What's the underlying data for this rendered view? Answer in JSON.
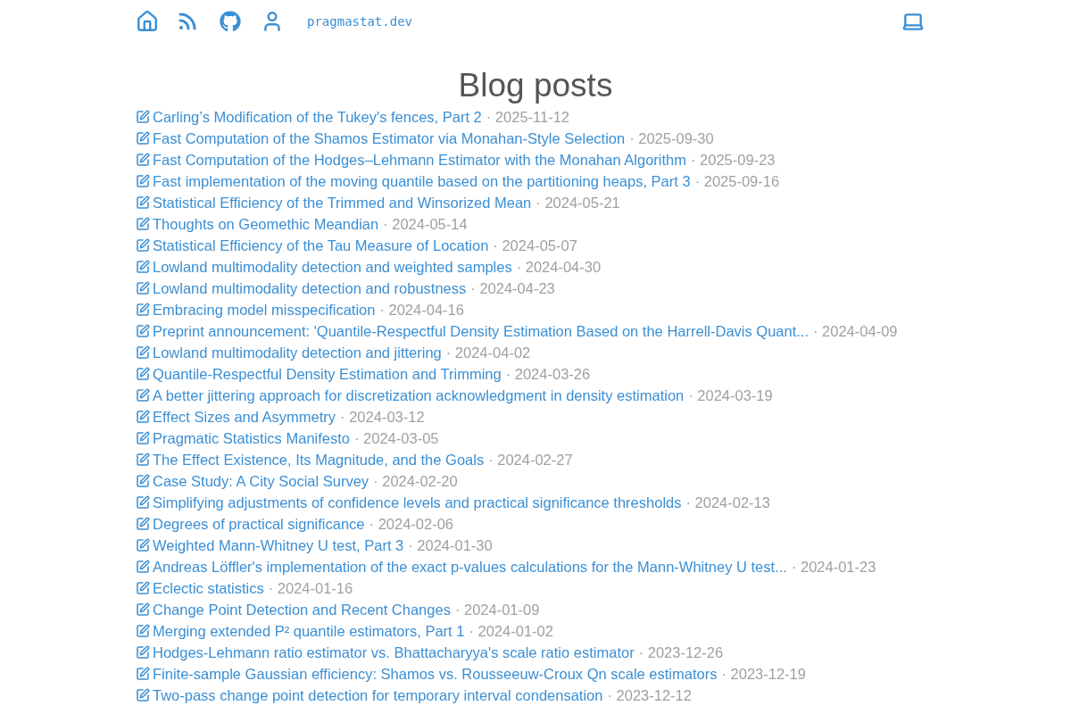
{
  "header": {
    "site": "pragmastat.dev"
  },
  "title": "Blog posts",
  "posts": [
    {
      "title": "Carling’s Modification of the Tukey's fences, Part 2",
      "date": "· 2025-11-12"
    },
    {
      "title": "Fast Computation of the Shamos Estimator via Monahan-Style Selection",
      "date": "· 2025-09-30"
    },
    {
      "title": "Fast Computation of the Hodges–Lehmann Estimator with the Monahan Algorithm",
      "date": "· 2025-09-23"
    },
    {
      "title": "Fast implementation of the moving quantile based on the partitioning heaps, Part 3",
      "date": "· 2025-09-16"
    },
    {
      "title": "Statistical Efficiency of the Trimmed and Winsorized Mean",
      "date": "· 2024-05-21"
    },
    {
      "title": "Thoughts on Geomethic Meandian",
      "date": "· 2024-05-14"
    },
    {
      "title": "Statistical Efficiency of the Tau Measure of Location",
      "date": "· 2024-05-07"
    },
    {
      "title": "Lowland multimodality detection and weighted samples",
      "date": "· 2024-04-30"
    },
    {
      "title": "Lowland multimodality detection and robustness",
      "date": "· 2024-04-23"
    },
    {
      "title": "Embracing model misspecification",
      "date": "· 2024-04-16"
    },
    {
      "title": "Preprint announcement: 'Quantile-Respectful Density Estimation Based on the Harrell-Davis Quant...",
      "date": "· 2024-04-09"
    },
    {
      "title": "Lowland multimodality detection and jittering",
      "date": "· 2024-04-02"
    },
    {
      "title": "Quantile-Respectful Density Estimation and Trimming",
      "date": "· 2024-03-26"
    },
    {
      "title": "A better jittering approach for discretization acknowledgment in density estimation",
      "date": "· 2024-03-19"
    },
    {
      "title": "Effect Sizes and Asymmetry",
      "date": "· 2024-03-12"
    },
    {
      "title": "Pragmatic Statistics Manifesto",
      "date": "· 2024-03-05"
    },
    {
      "title": "The Effect Existence, Its Magnitude, and the Goals",
      "date": "· 2024-02-27"
    },
    {
      "title": "Case Study: A City Social Survey",
      "date": "· 2024-02-20"
    },
    {
      "title": "Simplifying adjustments of confidence levels and practical significance thresholds",
      "date": "· 2024-02-13"
    },
    {
      "title": "Degrees of practical significance",
      "date": "· 2024-02-06"
    },
    {
      "title": "Weighted Mann-Whitney U test, Part 3",
      "date": "· 2024-01-30"
    },
    {
      "title": "Andreas Löffler's implementation of the exact p-values calculations for the Mann-Whitney U test...",
      "date": "· 2024-01-23"
    },
    {
      "title": "Eclectic statistics",
      "date": "· 2024-01-16"
    },
    {
      "title": "Change Point Detection and Recent Changes",
      "date": "· 2024-01-09"
    },
    {
      "title": "Merging extended P² quantile estimators, Part 1",
      "date": "· 2024-01-02"
    },
    {
      "title": "Hodges-Lehmann ratio estimator vs. Bhattacharyya's scale ratio estimator",
      "date": "· 2023-12-26"
    },
    {
      "title": "Finite-sample Gaussian efficiency: Shamos vs. Rousseeuw-Croux Qn scale estimators",
      "date": "· 2023-12-19"
    },
    {
      "title": "Two-pass change point detection for temporary interval condensation",
      "date": "· 2023-12-12"
    }
  ]
}
